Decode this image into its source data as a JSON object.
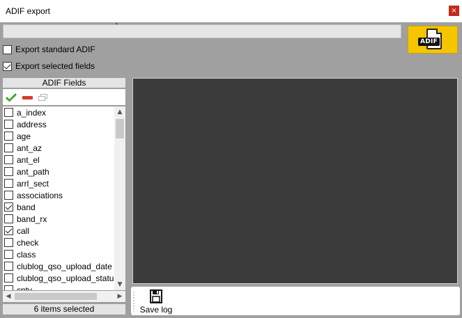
{
  "window": {
    "title": "ADIF export",
    "close_label": "×"
  },
  "progress": {
    "fraction": 0.0
  },
  "logo": {
    "text": "ADIF"
  },
  "options": {
    "export_standard": {
      "label": "Export standard ADIF",
      "checked": false
    },
    "export_selected": {
      "label": "Export selected fields",
      "checked": true
    }
  },
  "fields_panel": {
    "header": "ADIF Fields",
    "toolbar": [
      "check-all-icon",
      "remove-icon",
      "windows-icon"
    ],
    "items": [
      {
        "label": "a_index",
        "checked": false
      },
      {
        "label": "address",
        "checked": false
      },
      {
        "label": "age",
        "checked": false
      },
      {
        "label": "ant_az",
        "checked": false
      },
      {
        "label": "ant_el",
        "checked": false
      },
      {
        "label": "ant_path",
        "checked": false
      },
      {
        "label": "arrl_sect",
        "checked": false
      },
      {
        "label": "associations",
        "checked": false
      },
      {
        "label": "band",
        "checked": true
      },
      {
        "label": "band_rx",
        "checked": false
      },
      {
        "label": "call",
        "checked": true
      },
      {
        "label": "check",
        "checked": false
      },
      {
        "label": "class",
        "checked": false
      },
      {
        "label": "clublog_qso_upload_date",
        "checked": false
      },
      {
        "label": "clublog_qso_upload_status",
        "checked": false
      },
      {
        "label": "cnty",
        "checked": false
      }
    ],
    "status": "6 items selected"
  },
  "scroll": {
    "up": "▲",
    "down": "▼",
    "left": "◀",
    "right": "▶"
  },
  "toolbar": {
    "save_label": "Save log"
  }
}
